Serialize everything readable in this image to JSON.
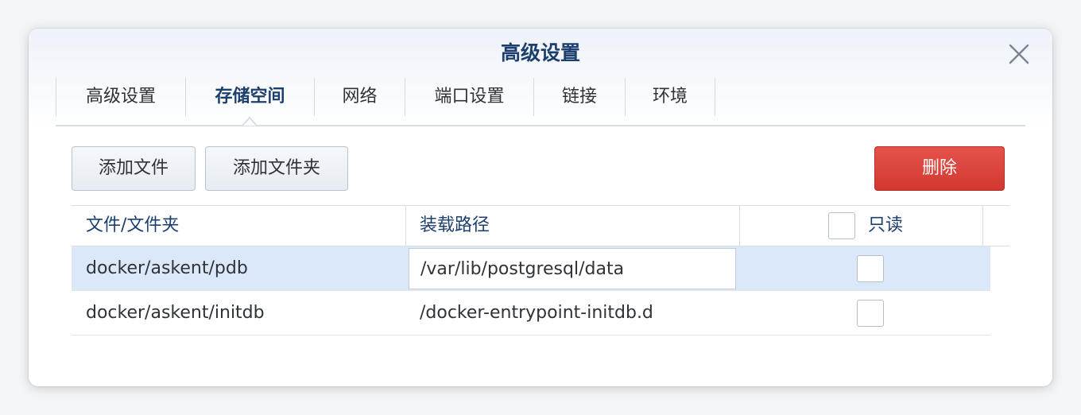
{
  "dialog": {
    "title": "高级设置",
    "tabs": [
      {
        "label": "高级设置"
      },
      {
        "label": "存储空间"
      },
      {
        "label": "网络"
      },
      {
        "label": "端口设置"
      },
      {
        "label": "链接"
      },
      {
        "label": "环境"
      }
    ],
    "active_tab": "存储空间"
  },
  "toolbar": {
    "add_file_label": "添加文件",
    "add_folder_label": "添加文件夹",
    "delete_label": "删除"
  },
  "table": {
    "columns": [
      "文件/文件夹",
      "装载路径",
      "只读"
    ],
    "rows": [
      {
        "file": "docker/askent/pdb",
        "mount_path": "/var/lib/postgresql/data",
        "readonly": false,
        "selected": true
      },
      {
        "file": "docker/askent/initdb",
        "mount_path": "/docker-entrypoint-initdb.d",
        "readonly": false,
        "selected": false
      }
    ]
  },
  "colors": {
    "title": "#1d3f6e",
    "delete_button": "#d9403a",
    "selected_row": "#dbe8fa"
  },
  "icons": {
    "close": "close-icon"
  }
}
